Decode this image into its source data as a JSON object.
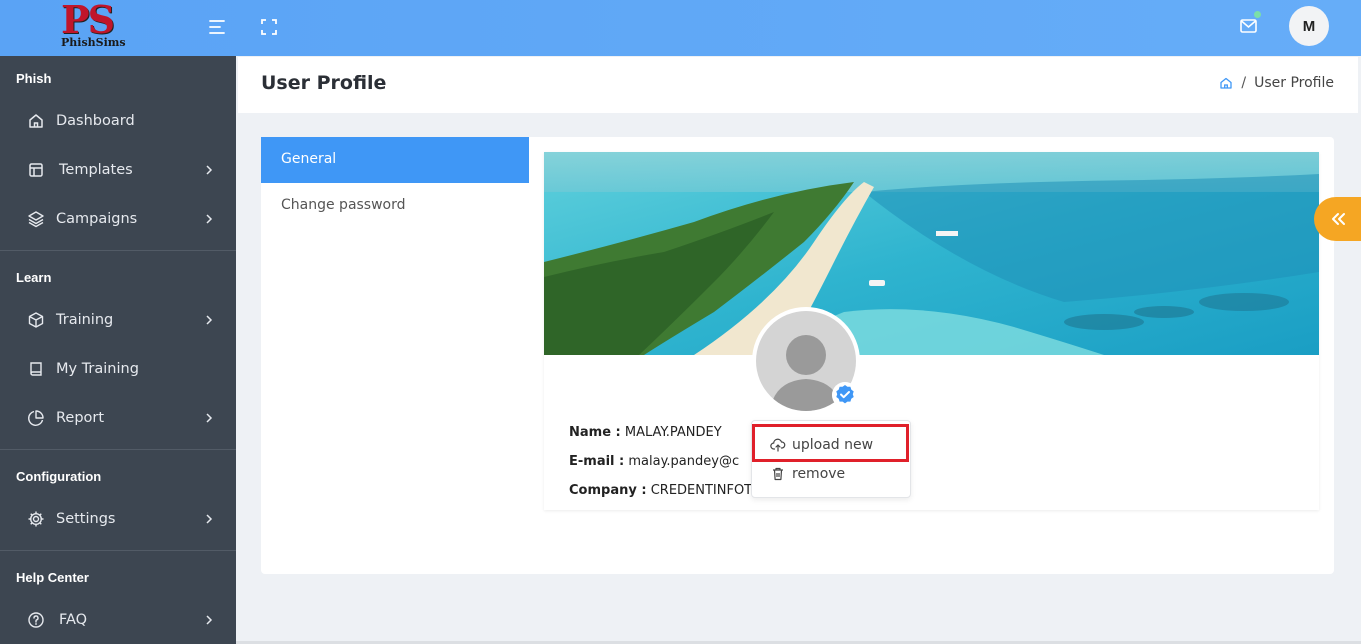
{
  "app": {
    "logo_text": "PS",
    "logo_subtext": "PhishSims"
  },
  "topbar": {
    "avatar_initial": "M"
  },
  "sidebar": {
    "sections": [
      {
        "title": "Phish"
      },
      {
        "title": "Learn"
      },
      {
        "title": "Configuration"
      },
      {
        "title": "Help Center"
      }
    ],
    "items": [
      {
        "label": "Dashboard",
        "icon": "home-icon"
      },
      {
        "label": "Templates",
        "icon": "template-icon"
      },
      {
        "label": "Campaigns",
        "icon": "layers-icon"
      },
      {
        "label": "Training",
        "icon": "box-icon"
      },
      {
        "label": "My Training",
        "icon": "book-icon"
      },
      {
        "label": "Report",
        "icon": "pie-chart-icon"
      },
      {
        "label": "Settings",
        "icon": "gear-icon"
      },
      {
        "label": "FAQ",
        "icon": "help-circle-icon"
      }
    ]
  },
  "header": {
    "title": "User Profile",
    "breadcrumb_current": "User Profile"
  },
  "tabs": {
    "general": "General",
    "change_password": "Change password"
  },
  "profile": {
    "name_label": "Name :",
    "name_value": "MALAY.PANDEY",
    "email_label": "E-mail :",
    "email_value": "malay.pandey@c",
    "company_label": "Company :",
    "company_value": "CREDENTINFOTE"
  },
  "photo_menu": {
    "upload": "upload new",
    "remove": "remove"
  },
  "colors": {
    "topbar": "#5aa3f5",
    "sidebar": "#3d4651",
    "accent": "#3f97f6",
    "float_button": "#f5a623",
    "highlight": "#e0202a"
  }
}
